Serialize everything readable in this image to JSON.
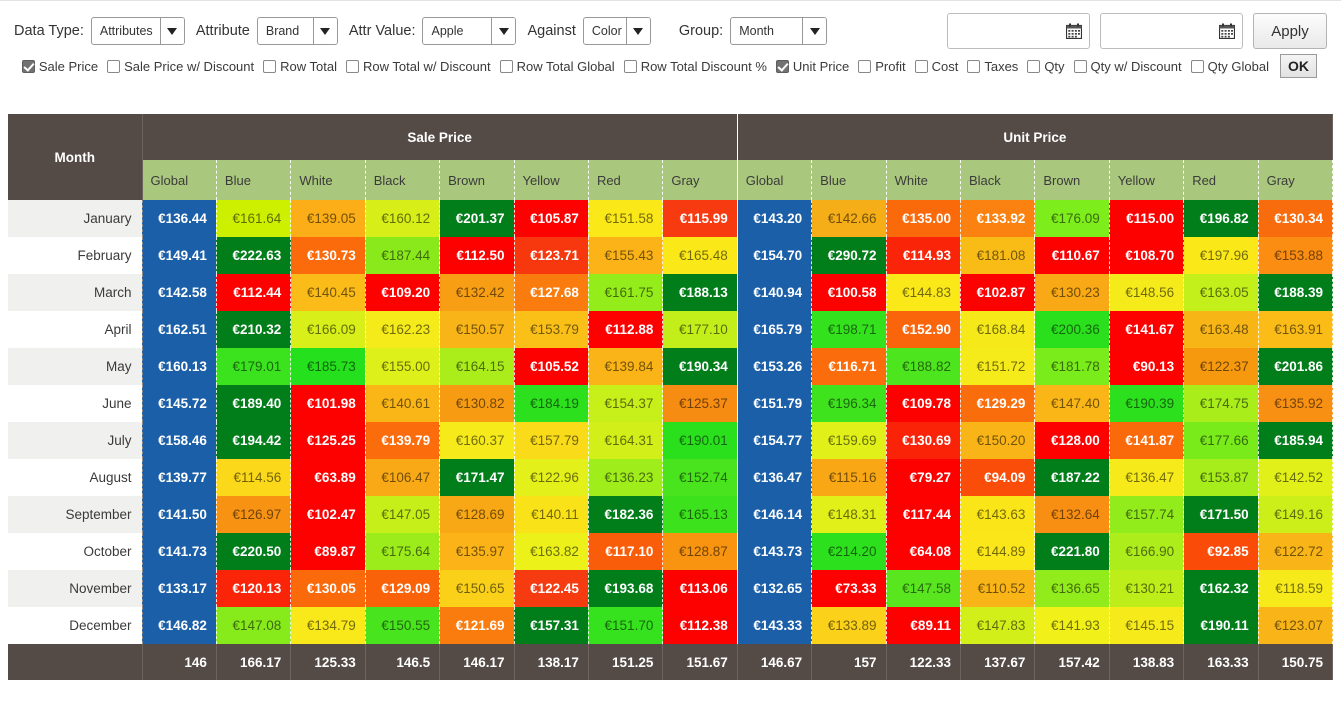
{
  "toolbar": {
    "data_type_label": "Data Type:",
    "data_type_value": "Attributes",
    "attribute_label": "Attribute",
    "attribute_value": "Brand",
    "attr_value_label": "Attr Value:",
    "attr_value_value": "Apple",
    "against_label": "Against",
    "against_value": "Color",
    "group_label": "Group:",
    "group_value": "Month",
    "date_from_value": "",
    "date_to_value": "",
    "apply_label": "Apply",
    "ok_label": "OK",
    "calendar_icon": "calendar-icon",
    "chevron_icon": "chevron-down-icon"
  },
  "metrics": [
    {
      "label": "Sale Price",
      "checked": true
    },
    {
      "label": "Sale Price w/ Discount",
      "checked": false
    },
    {
      "label": "Row Total",
      "checked": false
    },
    {
      "label": "Row Total w/ Discount",
      "checked": false
    },
    {
      "label": "Row Total Global",
      "checked": false
    },
    {
      "label": "Row Total Discount %",
      "checked": false
    },
    {
      "label": "Unit Price",
      "checked": true
    },
    {
      "label": "Profit",
      "checked": false
    },
    {
      "label": "Cost",
      "checked": false
    },
    {
      "label": "Taxes",
      "checked": false
    },
    {
      "label": "Qty",
      "checked": false
    },
    {
      "label": "Qty w/ Discount",
      "checked": false
    },
    {
      "label": "Qty Global",
      "checked": false
    }
  ],
  "chart_data": {
    "type": "heatmap",
    "title": "",
    "row_header": "Month",
    "groups": [
      "Sale Price",
      "Unit Price"
    ],
    "subcolumns": [
      "Global",
      "Blue",
      "White",
      "Black",
      "Brown",
      "Yellow",
      "Red",
      "Gray"
    ],
    "categories": [
      "January",
      "February",
      "March",
      "April",
      "May",
      "June",
      "July",
      "August",
      "September",
      "October",
      "November",
      "December"
    ],
    "currency": "€",
    "rows": [
      {
        "month": "January",
        "sale_price": [
          "€136.44",
          "€161.64",
          "€139.05",
          "€160.12",
          "€201.37",
          "€105.87",
          "€151.58",
          "€115.99"
        ],
        "unit_price": [
          "€143.20",
          "€142.66",
          "€135.00",
          "€133.92",
          "€176.09",
          "€115.00",
          "€196.82",
          "€130.34"
        ],
        "sale_colors": [
          "#1a5fa8",
          "#ccf000",
          "#fbae17",
          "#d7ee18",
          "#017d1a",
          "#fd0000",
          "#fbe819",
          "#f73a10"
        ],
        "unit_colors": [
          "#1a5fa8",
          "#f6ae18",
          "#fa6a0b",
          "#fb8210",
          "#7ded1b",
          "#fd0000",
          "#017d1a",
          "#f86c0d"
        ],
        "sale_bold": [
          true,
          false,
          false,
          false,
          true,
          true,
          false,
          true
        ],
        "unit_bold": [
          true,
          false,
          true,
          true,
          false,
          true,
          true,
          true
        ]
      },
      {
        "month": "February",
        "sale_price": [
          "€149.41",
          "€222.63",
          "€130.73",
          "€187.44",
          "€112.50",
          "€123.71",
          "€155.43",
          "€165.48"
        ],
        "unit_price": [
          "€154.70",
          "€290.72",
          "€114.93",
          "€181.08",
          "€110.67",
          "€108.70",
          "€197.96",
          "€153.88"
        ],
        "sale_colors": [
          "#1a5fa8",
          "#017d1a",
          "#fb6a0b",
          "#89e91b",
          "#fd0000",
          "#f7380f",
          "#fbb318",
          "#fbe819"
        ],
        "unit_colors": [
          "#1a5fa8",
          "#017d1a",
          "#fa2408",
          "#f9bc17",
          "#fd0000",
          "#fd0000",
          "#fbe819",
          "#fa8d12"
        ],
        "sale_bold": [
          true,
          true,
          true,
          false,
          true,
          true,
          false,
          false
        ],
        "unit_bold": [
          true,
          true,
          true,
          false,
          true,
          true,
          false,
          false
        ]
      },
      {
        "month": "March",
        "sale_price": [
          "€142.58",
          "€112.44",
          "€140.45",
          "€109.20",
          "€132.42",
          "€127.68",
          "€161.75",
          "€188.13"
        ],
        "unit_price": [
          "€140.94",
          "€100.58",
          "€144.83",
          "€102.87",
          "€130.23",
          "€148.56",
          "€163.05",
          "€188.39"
        ],
        "sale_colors": [
          "#1a5fa8",
          "#fd0000",
          "#fbbb18",
          "#fd0000",
          "#f89e14",
          "#fb7c0e",
          "#95ec1b",
          "#017d1a"
        ],
        "unit_colors": [
          "#1a5fa8",
          "#fd0000",
          "#fbe819",
          "#fd0000",
          "#f9a915",
          "#f5ea1a",
          "#c3ef1a",
          "#017d1a"
        ],
        "sale_bold": [
          true,
          true,
          false,
          true,
          false,
          true,
          false,
          true
        ],
        "unit_bold": [
          true,
          true,
          false,
          true,
          false,
          false,
          false,
          true
        ]
      },
      {
        "month": "April",
        "sale_price": [
          "€162.51",
          "€210.32",
          "€166.09",
          "€162.23",
          "€150.57",
          "€153.79",
          "€112.88",
          "€177.10"
        ],
        "unit_price": [
          "€165.79",
          "€198.71",
          "€152.90",
          "€168.84",
          "€200.36",
          "€141.67",
          "€163.48",
          "€163.91"
        ],
        "sale_colors": [
          "#1a5fa8",
          "#017d1a",
          "#d8ef19",
          "#f5ea1a",
          "#f9b417",
          "#fbc018",
          "#fd0000",
          "#c2ef1a"
        ],
        "unit_colors": [
          "#1a5fa8",
          "#33e21d",
          "#fa650b",
          "#f6e91a",
          "#2ae01d",
          "#fd0000",
          "#f8b516",
          "#fbbc18"
        ],
        "sale_bold": [
          true,
          true,
          false,
          false,
          false,
          false,
          true,
          false
        ],
        "unit_bold": [
          true,
          false,
          true,
          false,
          false,
          true,
          false,
          false
        ]
      },
      {
        "month": "May",
        "sale_price": [
          "€160.13",
          "€179.01",
          "€185.73",
          "€155.00",
          "€164.15",
          "€105.52",
          "€139.84",
          "€190.34"
        ],
        "unit_price": [
          "€153.26",
          "€116.71",
          "€188.82",
          "€151.72",
          "€181.78",
          "€90.13",
          "€122.37",
          "€201.86"
        ],
        "sale_colors": [
          "#1a5fa8",
          "#3ae31d",
          "#25e01c",
          "#ddf019",
          "#abed1b",
          "#fd0000",
          "#fab417",
          "#017d1a"
        ],
        "unit_colors": [
          "#1a5fa8",
          "#fa6c0c",
          "#4ce51e",
          "#f5ea1a",
          "#7aeb1b",
          "#fd0000",
          "#f7990f",
          "#017d1a"
        ],
        "sale_bold": [
          true,
          false,
          false,
          false,
          false,
          true,
          false,
          true
        ],
        "unit_bold": [
          true,
          true,
          false,
          false,
          false,
          true,
          false,
          true
        ]
      },
      {
        "month": "June",
        "sale_price": [
          "€145.72",
          "€189.40",
          "€101.98",
          "€140.61",
          "€130.82",
          "€184.19",
          "€154.37",
          "€125.37"
        ],
        "unit_price": [
          "€151.79",
          "€196.34",
          "€109.78",
          "€129.29",
          "€147.40",
          "€190.39",
          "€174.75",
          "€135.92"
        ],
        "sale_colors": [
          "#1a5fa8",
          "#017d1a",
          "#fd0000",
          "#fab617",
          "#f79b13",
          "#2ce01d",
          "#c7ef1a",
          "#f78c12"
        ],
        "unit_colors": [
          "#1a5fa8",
          "#3ee31d",
          "#fd0000",
          "#f96d0c",
          "#fab617",
          "#2de01d",
          "#a9ed1b",
          "#f89113"
        ],
        "sale_bold": [
          true,
          true,
          true,
          false,
          false,
          false,
          false,
          false
        ],
        "unit_bold": [
          true,
          false,
          true,
          true,
          false,
          false,
          false,
          false
        ]
      },
      {
        "month": "July",
        "sale_price": [
          "€158.46",
          "€194.42",
          "€125.25",
          "€139.79",
          "€160.37",
          "€157.79",
          "€164.31",
          "€190.01"
        ],
        "unit_price": [
          "€154.77",
          "€159.69",
          "€130.69",
          "€150.20",
          "€128.00",
          "€141.87",
          "€177.66",
          "€185.94"
        ],
        "sale_colors": [
          "#1a5fa8",
          "#017d1a",
          "#fd0000",
          "#fb6c0c",
          "#f6ea1a",
          "#f9db19",
          "#d3ef19",
          "#2ae01d"
        ],
        "unit_colors": [
          "#1a5fa8",
          "#e1f019",
          "#fa2308",
          "#f9b417",
          "#fd0000",
          "#fa6a0b",
          "#79eb1b",
          "#017d1a"
        ],
        "sale_bold": [
          true,
          true,
          true,
          true,
          false,
          false,
          false,
          false
        ],
        "unit_bold": [
          true,
          false,
          true,
          false,
          true,
          true,
          false,
          true
        ]
      },
      {
        "month": "August",
        "sale_price": [
          "€139.77",
          "€114.56",
          "€63.89",
          "€106.47",
          "€171.47",
          "€122.96",
          "€136.23",
          "€152.74"
        ],
        "unit_price": [
          "€136.47",
          "€115.16",
          "€79.27",
          "€94.09",
          "€187.22",
          "€136.47",
          "€153.87",
          "€142.52"
        ],
        "sale_colors": [
          "#1a5fa8",
          "#fbd819",
          "#fd0000",
          "#f8a915",
          "#017d1a",
          "#e4f019",
          "#9fed1b",
          "#4ae41e"
        ],
        "unit_colors": [
          "#1a5fa8",
          "#f9a715",
          "#fd0000",
          "#fa4d0a",
          "#017d1a",
          "#f7ea1a",
          "#a6ed1b",
          "#e2f019"
        ],
        "sale_bold": [
          true,
          false,
          true,
          false,
          true,
          false,
          false,
          false
        ],
        "unit_bold": [
          true,
          false,
          true,
          true,
          true,
          false,
          false,
          false
        ]
      },
      {
        "month": "September",
        "sale_price": [
          "€141.50",
          "€126.97",
          "€102.47",
          "€147.05",
          "€128.69",
          "€140.11",
          "€182.36",
          "€165.13"
        ],
        "unit_price": [
          "€146.14",
          "€148.31",
          "€117.44",
          "€143.63",
          "€132.64",
          "€157.74",
          "€171.50",
          "€149.16"
        ],
        "sale_colors": [
          "#1a5fa8",
          "#f79213",
          "#fd0000",
          "#c6ef1a",
          "#f8a715",
          "#fae219",
          "#017d1a",
          "#3ce31d"
        ],
        "unit_colors": [
          "#1a5fa8",
          "#e2f019",
          "#fd0000",
          "#fae519",
          "#f88f13",
          "#92ec1b",
          "#017d1a",
          "#ccef1a"
        ],
        "sale_bold": [
          true,
          false,
          true,
          false,
          false,
          false,
          true,
          false
        ],
        "unit_bold": [
          true,
          false,
          true,
          false,
          false,
          false,
          true,
          false
        ]
      },
      {
        "month": "October",
        "sale_price": [
          "€141.73",
          "€220.50",
          "€89.87",
          "€175.64",
          "€135.97",
          "€163.82",
          "€117.10",
          "€128.87"
        ],
        "unit_price": [
          "€143.73",
          "€214.20",
          "€64.08",
          "€144.89",
          "€221.80",
          "€166.90",
          "€92.85",
          "€122.72"
        ],
        "sale_colors": [
          "#1a5fa8",
          "#017d1a",
          "#fd0000",
          "#9cec1b",
          "#fbb317",
          "#ebf119",
          "#fa5d0a",
          "#f8940f"
        ],
        "unit_colors": [
          "#1a5fa8",
          "#2ce01d",
          "#fd0000",
          "#fae619",
          "#017d1a",
          "#aded1b",
          "#fa4b09",
          "#f9b417"
        ],
        "sale_bold": [
          true,
          true,
          true,
          false,
          false,
          false,
          true,
          false
        ],
        "unit_bold": [
          true,
          false,
          true,
          false,
          true,
          false,
          true,
          false
        ]
      },
      {
        "month": "November",
        "sale_price": [
          "€133.17",
          "€120.13",
          "€130.05",
          "€129.09",
          "€150.65",
          "€122.45",
          "€193.68",
          "€113.06"
        ],
        "unit_price": [
          "€132.65",
          "€73.33",
          "€147.58",
          "€110.52",
          "€136.65",
          "€130.21",
          "€162.32",
          "€118.59"
        ],
        "sale_colors": [
          "#1a5fa8",
          "#fa2408",
          "#fa6a0b",
          "#fa620a",
          "#fad019",
          "#f63b10",
          "#017d1a",
          "#fd0000"
        ],
        "unit_colors": [
          "#1a5fa8",
          "#fd0000",
          "#59e61f",
          "#f9b417",
          "#92ec1b",
          "#bdee1a",
          "#017d1a",
          "#f7ea1a"
        ],
        "sale_bold": [
          true,
          true,
          true,
          true,
          false,
          true,
          true,
          true
        ],
        "unit_bold": [
          true,
          true,
          false,
          false,
          false,
          false,
          true,
          false
        ]
      },
      {
        "month": "December",
        "sale_price": [
          "€146.82",
          "€147.08",
          "€134.79",
          "€150.55",
          "€121.69",
          "€157.31",
          "€151.70",
          "€112.38"
        ],
        "unit_price": [
          "€143.33",
          "€133.89",
          "€89.11",
          "€147.83",
          "€141.93",
          "€145.15",
          "€190.11",
          "€123.07"
        ],
        "sale_colors": [
          "#1a5fa8",
          "#86ea1b",
          "#f9e81a",
          "#48e41e",
          "#fb7c0e",
          "#017d1a",
          "#35e21d",
          "#fd0000"
        ],
        "unit_colors": [
          "#1a5fa8",
          "#fbd119",
          "#fd0000",
          "#d3ef19",
          "#f1f119",
          "#f6ea1a",
          "#017d1a",
          "#f9b417"
        ],
        "sale_bold": [
          true,
          false,
          false,
          false,
          true,
          true,
          false,
          true
        ],
        "unit_bold": [
          true,
          false,
          true,
          false,
          false,
          false,
          true,
          false
        ]
      }
    ],
    "totals": {
      "sale_price": [
        "146",
        "166.17",
        "125.33",
        "146.5",
        "146.17",
        "138.17",
        "151.25",
        "151.67"
      ],
      "unit_price": [
        "146.67",
        "157",
        "122.33",
        "137.67",
        "157.42",
        "138.83",
        "163.33",
        "150.75"
      ]
    }
  },
  "colors": {
    "header_dark": "#544b47",
    "header_green": "#aac77e",
    "global_blue": "#1a5fa8",
    "high_green": "#017d1a",
    "low_red": "#fd0000"
  }
}
